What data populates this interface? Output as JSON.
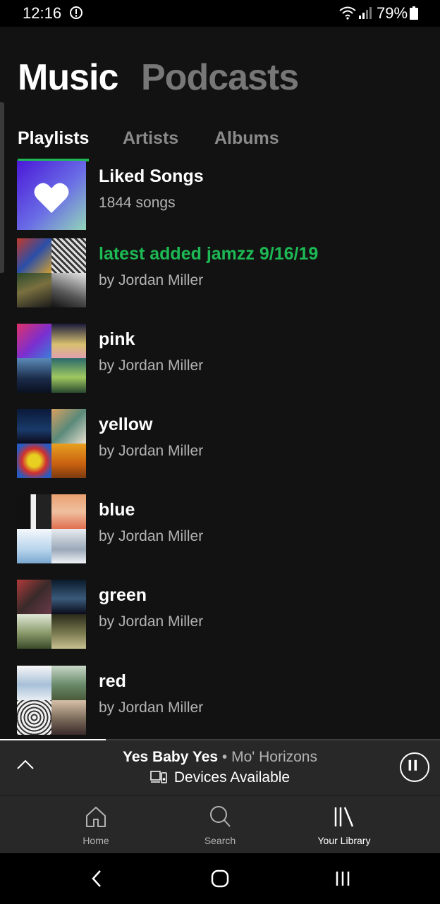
{
  "status_bar": {
    "time": "12:16",
    "battery": "79%"
  },
  "top_tabs": {
    "music": "Music",
    "podcasts": "Podcasts"
  },
  "sub_tabs": {
    "playlists": "Playlists",
    "artists": "Artists",
    "albums": "Albums"
  },
  "playlists": [
    {
      "title": "Liked Songs",
      "subtitle": "1844 songs"
    },
    {
      "title": "latest added jamzz 9/16/19",
      "subtitle": "by Jordan Miller"
    },
    {
      "title": "pink",
      "subtitle": "by Jordan Miller"
    },
    {
      "title": "yellow",
      "subtitle": "by Jordan Miller"
    },
    {
      "title": "blue",
      "subtitle": "by Jordan Miller"
    },
    {
      "title": "green",
      "subtitle": "by Jordan Miller"
    },
    {
      "title": "red",
      "subtitle": "by Jordan Miller"
    }
  ],
  "player": {
    "track": "Yes Baby Yes",
    "separator": "•",
    "artist": "Mo' Horizons",
    "devices": "Devices Available",
    "progress": 0.24
  },
  "bottom_nav": {
    "home": "Home",
    "search": "Search",
    "library": "Your Library"
  },
  "colors": {
    "accent": "#1db954",
    "background": "#121212",
    "bar": "#282828"
  }
}
